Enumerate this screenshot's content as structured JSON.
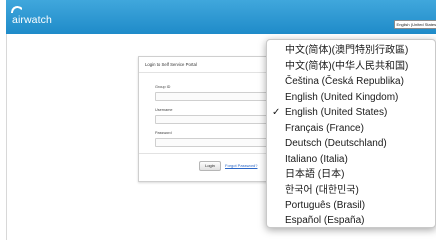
{
  "header": {
    "logo_text": "airwatch",
    "language_button": "English (United States)",
    "brand_color": "#2596d3"
  },
  "login": {
    "title": "Login to Self Service Portal",
    "group_id_label": "Group ID",
    "username_label": "Username",
    "password_label": "Password",
    "login_button": "Login",
    "forgot_link": "Forgot Password?"
  },
  "language_menu": {
    "items": [
      {
        "label": "中文(简体)(澳門特別行政區)",
        "selected": false
      },
      {
        "label": "中文(简体)(中华人民共和国)",
        "selected": false
      },
      {
        "label": "Čeština (Česká Republika)",
        "selected": false
      },
      {
        "label": "English (United Kingdom)",
        "selected": false
      },
      {
        "label": "English (United States)",
        "selected": true
      },
      {
        "label": "Français (France)",
        "selected": false
      },
      {
        "label": "Deutsch (Deutschland)",
        "selected": false
      },
      {
        "label": "Italiano (Italia)",
        "selected": false
      },
      {
        "label": "日本語 (日本)",
        "selected": false
      },
      {
        "label": "한국어 (대한민국)",
        "selected": false
      },
      {
        "label": "Português (Brasil)",
        "selected": false
      },
      {
        "label": "Español (España)",
        "selected": false
      }
    ],
    "check_glyph": "✓"
  }
}
